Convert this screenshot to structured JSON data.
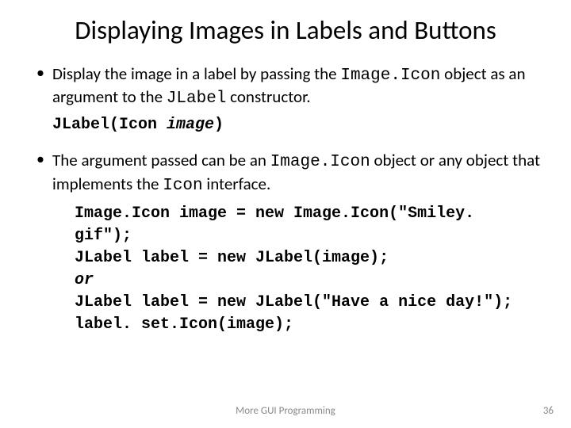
{
  "title": "Displaying Images in Labels and Buttons",
  "bullet1": {
    "pre": "Display the image in a label by passing the ",
    "code1": "Image.Icon",
    "mid": " object as an argument to the ",
    "code2": "JLabel",
    "post": " constructor."
  },
  "snippet1": {
    "pre": "JLabel(Icon ",
    "arg": "image",
    "post": ")"
  },
  "bullet2": {
    "pre": "The argument passed can be an ",
    "code1": "Image.Icon",
    "mid": " object or any object that implements the ",
    "code2": "Icon",
    "post": " interface."
  },
  "snippet2": {
    "l1": "Image.Icon image = new Image.Icon(\"Smiley. gif\");",
    "l2": "JLabel label = new JLabel(image);",
    "l3": "or",
    "l4": "JLabel label = new JLabel(\"Have a nice day!\");",
    "l5": "label. set.Icon(image);"
  },
  "footer": {
    "center": "More GUI Programming",
    "page": "36"
  }
}
